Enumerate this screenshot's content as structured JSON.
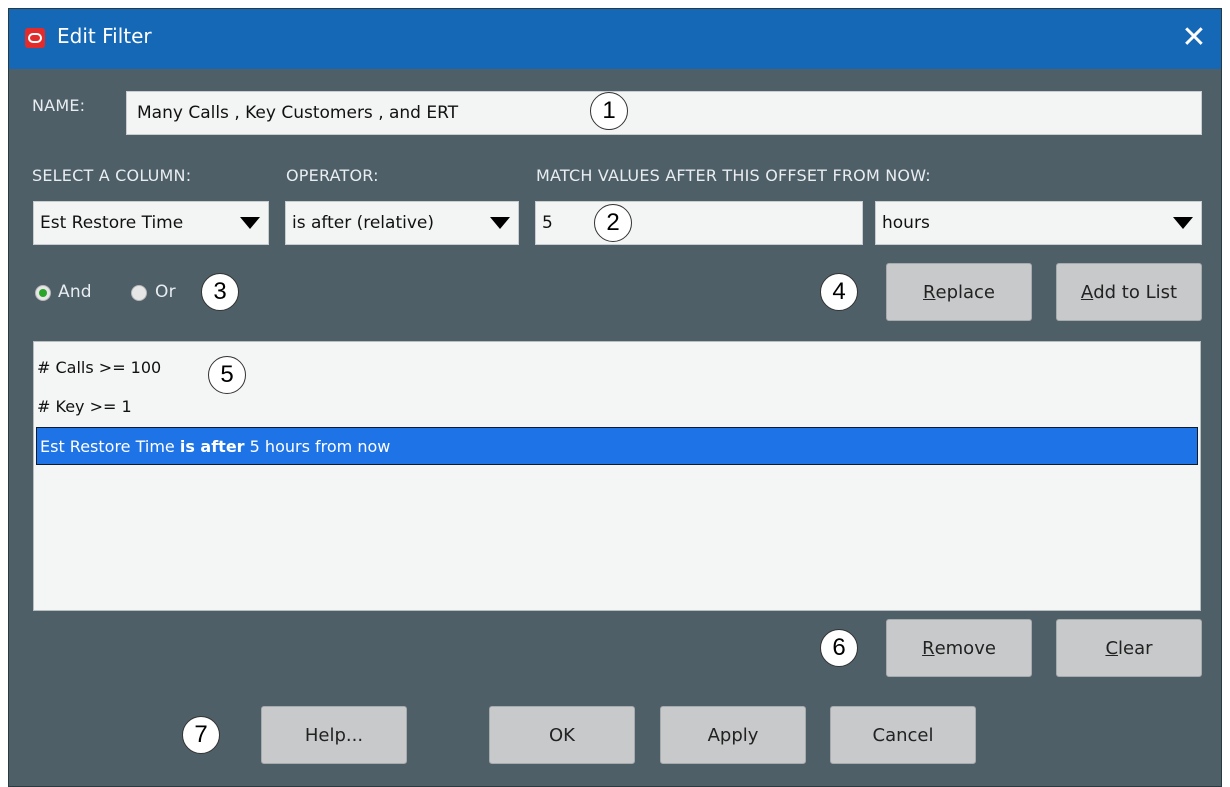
{
  "window": {
    "title": "Edit Filter",
    "close_glyph": "✕"
  },
  "name": {
    "label": "NAME:",
    "value": "Many Calls , Key Customers , and ERT"
  },
  "column": {
    "label": "SELECT A COLUMN:",
    "selected": "Est Restore Time"
  },
  "operator": {
    "label": "OPERATOR:",
    "selected": "is after (relative)"
  },
  "match": {
    "label": "MATCH VALUES AFTER THIS OFFSET FROM NOW:",
    "value": "5",
    "unit": "hours"
  },
  "logic": {
    "and_label": "And",
    "or_label": "Or",
    "selected": "And"
  },
  "buttons": {
    "replace_mnemonic": "R",
    "replace_rest": "eplace",
    "add_mnemonic": "A",
    "add_rest": "dd to List",
    "remove_mnemonic": "R",
    "remove_rest": "emove",
    "clear_mnemonic": "C",
    "clear_rest": "lear",
    "help": "Help...",
    "ok": "OK",
    "apply": "Apply",
    "cancel": "Cancel"
  },
  "filter_list": {
    "items": [
      {
        "text": "# Calls >= 100"
      },
      {
        "text": "# Key >= 1"
      }
    ],
    "selected_item": {
      "column": "Est Restore Time ",
      "operator": "is after",
      "rest": " 5 hours from now"
    }
  },
  "callouts": [
    "1",
    "2",
    "3",
    "4",
    "5",
    "6",
    "7"
  ],
  "colors": {
    "title_bar": "#1568b6",
    "dialog_bg": "#4f5f68",
    "selection": "#1e73e6",
    "radio_checked": "#2aa52a",
    "logo": "#e42b2b"
  },
  "icons": {
    "logo": "oracle-logo-icon",
    "close": "close-icon",
    "dropdown": "dropdown-arrow-icon"
  }
}
